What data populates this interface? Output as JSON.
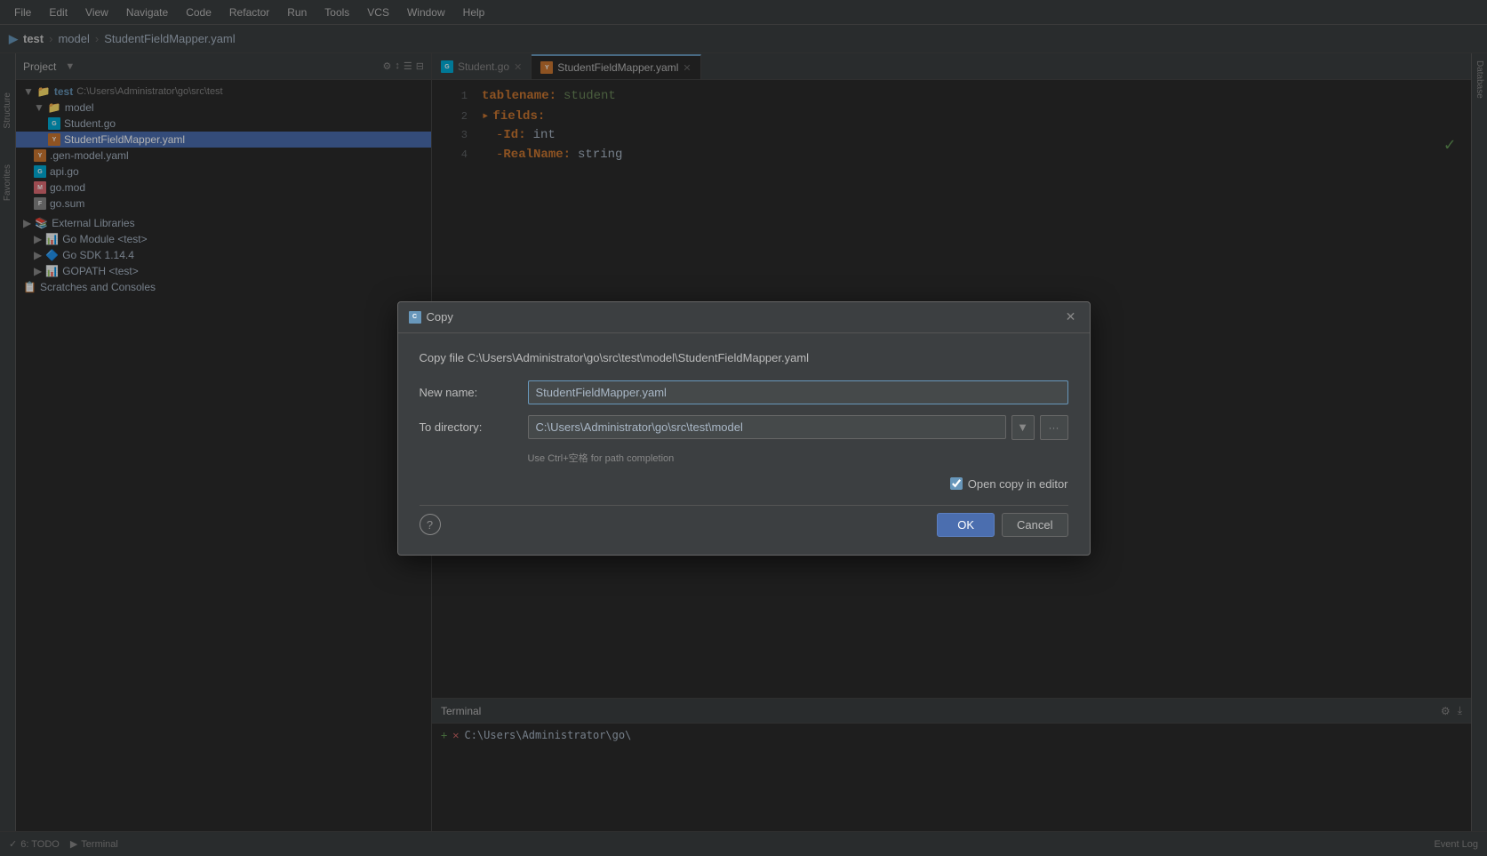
{
  "menu": {
    "items": [
      "File",
      "Edit",
      "View",
      "Navigate",
      "Code",
      "Refactor",
      "Run",
      "Tools",
      "VCS",
      "Window",
      "Help"
    ]
  },
  "titlebar": {
    "project": "test",
    "folder": "model",
    "file": "StudentFieldMapper.yaml"
  },
  "project_panel": {
    "title": "Project",
    "root": {
      "name": "test",
      "path": "C:\\Users\\Administrator\\go\\src\\test",
      "children": [
        {
          "name": "model",
          "type": "folder",
          "children": [
            {
              "name": "Student.go",
              "type": "go"
            },
            {
              "name": "StudentFieldMapper.yaml",
              "type": "yaml",
              "selected": true
            }
          ]
        },
        {
          "name": ".gen-model.yaml",
          "type": "yaml"
        },
        {
          "name": "api.go",
          "type": "go"
        },
        {
          "name": "go.mod",
          "type": "mod"
        },
        {
          "name": "go.sum",
          "type": "file"
        }
      ]
    },
    "external_libraries": {
      "name": "External Libraries",
      "children": [
        {
          "name": "Go Module <test>",
          "type": "lib"
        },
        {
          "name": "Go SDK 1.14.4",
          "type": "lib"
        },
        {
          "name": "GOPATH <test>",
          "type": "lib"
        }
      ]
    },
    "scratches": "Scratches and Consoles"
  },
  "tabs": [
    {
      "id": "student-go",
      "label": "Student.go",
      "active": false
    },
    {
      "id": "studentfieldmapper-yaml",
      "label": "StudentFieldMapper.yaml",
      "active": true
    }
  ],
  "editor": {
    "lines": [
      {
        "num": "1",
        "content": "tablename:",
        "value": "student",
        "type": "keyval"
      },
      {
        "num": "2",
        "content": "fields:",
        "type": "key"
      },
      {
        "num": "3",
        "content": "- Id:",
        "value": "int",
        "type": "dashkeyval"
      },
      {
        "num": "4",
        "content": "- RealName:",
        "value": "string",
        "type": "dashkeyval"
      }
    ]
  },
  "dialog": {
    "title": "Copy",
    "icon": "copy",
    "description": "Copy file C:\\Users\\Administrator\\go\\src\\test\\model\\StudentFieldMapper.yaml",
    "new_name_label": "New name:",
    "new_name_value": "StudentFieldMapper.yaml",
    "new_name_selected": "StudentFieldMapper",
    "to_dir_label": "To directory:",
    "to_dir_value": "C:\\Users\\Administrator\\go\\src\\test\\model",
    "hint": "Use Ctrl+空格 for path completion",
    "checkbox_label": "Open copy in editor",
    "checkbox_checked": true,
    "ok_label": "OK",
    "cancel_label": "Cancel"
  },
  "terminal": {
    "title": "Terminal",
    "prompt": "C:\\Users\\Administrator\\go\\"
  },
  "statusbar": {
    "todo": "6: TODO",
    "terminal": "Terminal",
    "event_log": "Event Log"
  }
}
